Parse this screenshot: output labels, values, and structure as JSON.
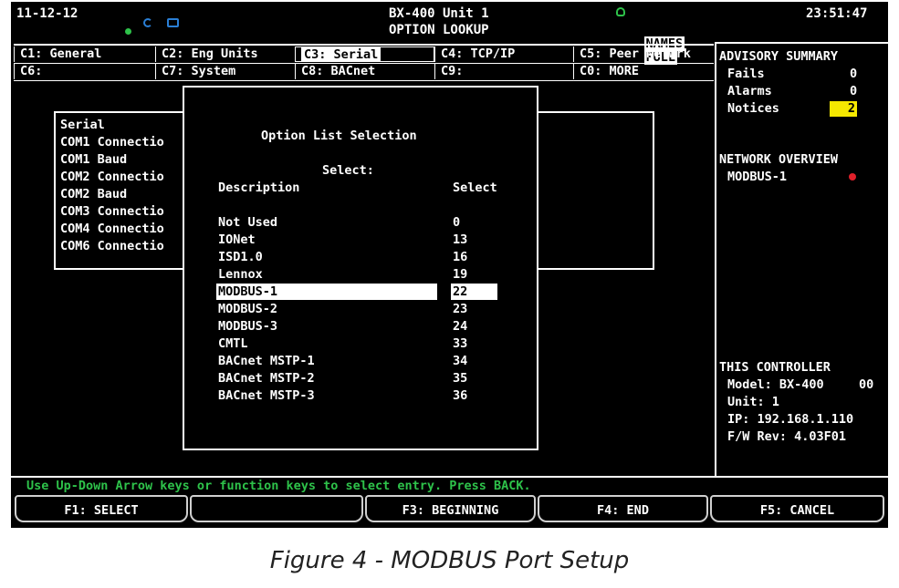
{
  "header": {
    "date": "11-12-12",
    "title_line1": "BX-400 Unit 1",
    "title_line2": "OPTION LOOKUP",
    "names_label": "NAMES",
    "full_label": "FULL",
    "time": "23:51:47"
  },
  "tabs": {
    "row1": [
      {
        "label": "C1: General"
      },
      {
        "label": "C2: Eng Units"
      },
      {
        "label": "C3: Serial",
        "selected": true
      },
      {
        "label": "C4: TCP/IP"
      },
      {
        "label": "C5: Peer Netwrk"
      }
    ],
    "row2": [
      {
        "label": "C6:"
      },
      {
        "label": "C7: System"
      },
      {
        "label": "C8: BACnet"
      },
      {
        "label": "C9:"
      },
      {
        "label": "C0: MORE"
      }
    ]
  },
  "serial_panel": {
    "title": "Serial",
    "rows": [
      "COM1 Connectio",
      "COM1 Baud",
      "COM2 Connectio",
      "COM2 Baud",
      "COM3 Connectio",
      "COM4 Connectio",
      "COM6 Connectio"
    ]
  },
  "popup": {
    "title": "Option List Selection",
    "select_label": "Select:",
    "col_description": "Description",
    "col_select": "Select",
    "options": [
      {
        "description": "Not Used",
        "value": "0"
      },
      {
        "description": "IONet",
        "value": "13"
      },
      {
        "description": "ISD1.0",
        "value": "16"
      },
      {
        "description": "Lennox",
        "value": "19"
      },
      {
        "description": "MODBUS-1",
        "value": "22",
        "highlighted": true
      },
      {
        "description": "MODBUS-2",
        "value": "23"
      },
      {
        "description": "MODBUS-3",
        "value": "24"
      },
      {
        "description": "CMTL",
        "value": "33"
      },
      {
        "description": "BACnet MSTP-1",
        "value": "34"
      },
      {
        "description": "BACnet MSTP-2",
        "value": "35"
      },
      {
        "description": "BACnet MSTP-3",
        "value": "36"
      }
    ]
  },
  "advisory": {
    "title": "ADVISORY SUMMARY",
    "fails_label": "Fails",
    "fails": "0",
    "alarms_label": "Alarms",
    "alarms": "0",
    "notices_label": "Notices",
    "notices": "2"
  },
  "network": {
    "title": "NETWORK OVERVIEW",
    "item": "MODBUS-1",
    "status_color": "#e0202a"
  },
  "controller": {
    "title": "THIS CONTROLLER",
    "model": "Model: BX-400",
    "model_suffix": "00",
    "unit": "Unit: 1",
    "ip": "IP: 192.168.1.110",
    "fw": "F/W Rev: 4.03F01"
  },
  "message": "Use Up-Down Arrow keys or function keys to select entry.  Press BACK.",
  "fkeys": {
    "f1": "F1: SELECT",
    "f2": "",
    "f3": "F3: BEGINNING",
    "f4": "F4: END",
    "f5": "F5: CANCEL"
  },
  "caption": "Figure 4 - MODBUS Port Setup",
  "colors": {
    "screen_bg": "#000000",
    "text": "#ffffff",
    "status_green": "#2ec24a",
    "notice_yellow": "#f5e800",
    "alert_red": "#e0202a"
  }
}
